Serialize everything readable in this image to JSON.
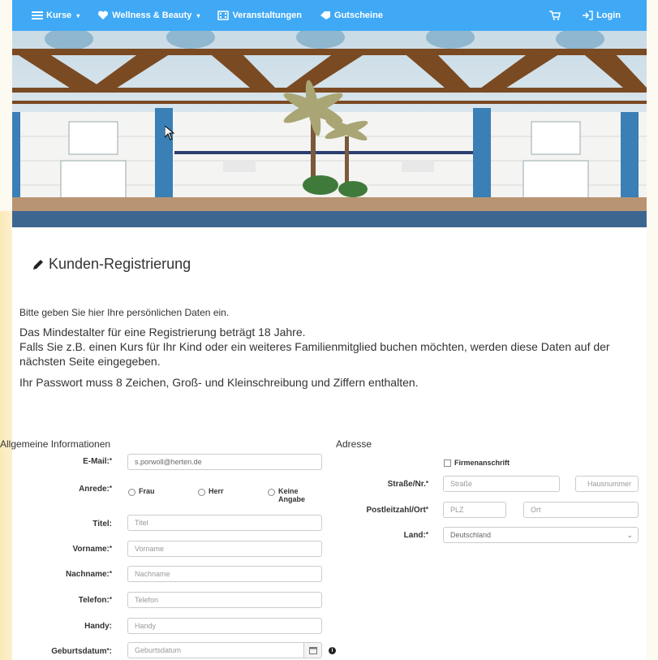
{
  "colors": {
    "navbar": "#3fa9f5",
    "band": "#3c6690",
    "accent_bg": "#fbe9b8"
  },
  "nav": {
    "items": [
      {
        "label": "Kurse",
        "icon": "list-icon"
      },
      {
        "label": "Wellness & Beauty",
        "icon": "heart-icon"
      },
      {
        "label": "Veranstaltungen",
        "icon": "building-icon"
      },
      {
        "label": "Gutscheine",
        "icon": "tag-icon"
      }
    ],
    "cart_icon": "cart-icon",
    "login_label": "Login",
    "login_icon": "sign-in-icon"
  },
  "hero": {
    "alt": "Hallenbad mit Palmen"
  },
  "page": {
    "title": "Kunden-Registrierung",
    "title_icon": "pencil-icon",
    "intro1": "Bitte geben Sie hier Ihre persönlichen Daten ein.",
    "intro2": "Das Mindestalter für eine Registrierung beträgt 18 Jahre.",
    "intro3": "Falls Sie z.B. einen Kurs für Ihr Kind oder ein weiteres Familienmitglied buchen möchten, werden diese Daten auf der nächsten Seite eingegeben.",
    "intro4": "Ihr Passwort muss 8 Zeichen, Groß- und Kleinschreibung und Ziffern enthalten."
  },
  "general": {
    "heading": "Allgemeine Informationen",
    "email_label": "E-Mail:",
    "email_value": "s.porwoll@herten.de",
    "salutation_label": "Anrede:",
    "salutation_options": [
      "Frau",
      "Herr",
      "Keine Angabe"
    ],
    "title_label": "Titel:",
    "title_placeholder": "Titel",
    "firstname_label": "Vorname:",
    "firstname_placeholder": "Vorname",
    "lastname_label": "Nachname:",
    "lastname_placeholder": "Nachname",
    "phone_label": "Telefon:",
    "phone_placeholder": "Telefon",
    "mobile_label": "Handy:",
    "mobile_placeholder": "Handy",
    "birthdate_label": "Geburtsdatum",
    "birthdate_placeholder": "Geburtsdatum",
    "required_mark": "*"
  },
  "address": {
    "heading": "Adresse",
    "company_checkbox": "Firmenanschrift",
    "street_label": "Straße/Nr.",
    "street_placeholder": "Straße",
    "housenumber_placeholder": "Hausnummer",
    "zip_label": "Postleitzahl/Ort",
    "zip_placeholder": "PLZ",
    "city_placeholder": "Ort",
    "country_label": "Land:",
    "country_value": "Deutschland"
  }
}
